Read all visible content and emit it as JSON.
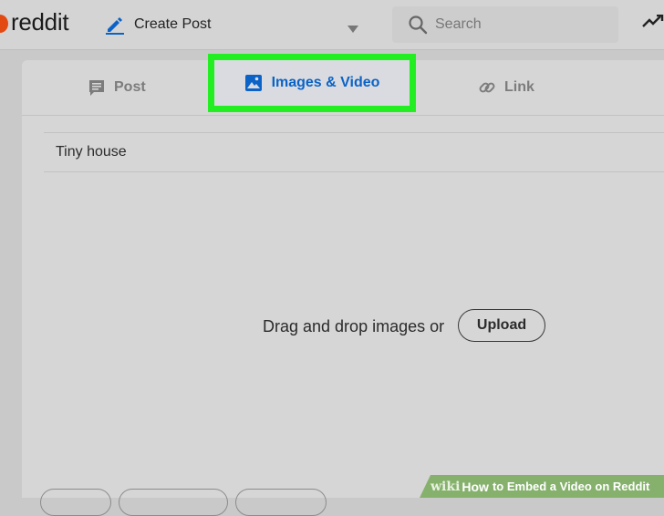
{
  "header": {
    "logo_text": "reddit",
    "create_post_label": "Create Post",
    "search_placeholder": "Search"
  },
  "tabs": [
    {
      "label": "Post",
      "icon": "post-icon",
      "active": false
    },
    {
      "label": "Images & Video",
      "icon": "image-icon",
      "active": true
    },
    {
      "label": "Link",
      "icon": "link-icon",
      "active": false
    }
  ],
  "form": {
    "title_value": "Tiny house",
    "dropzone_text": "Drag and drop images or",
    "upload_label": "Upload"
  },
  "watermark": {
    "brand": "wiki",
    "how": "How",
    "title": "to Embed a Video on Reddit"
  },
  "colors": {
    "highlight": "#22ee22",
    "active_tab_text": "#0b63c7",
    "logo": "#e34a12"
  }
}
